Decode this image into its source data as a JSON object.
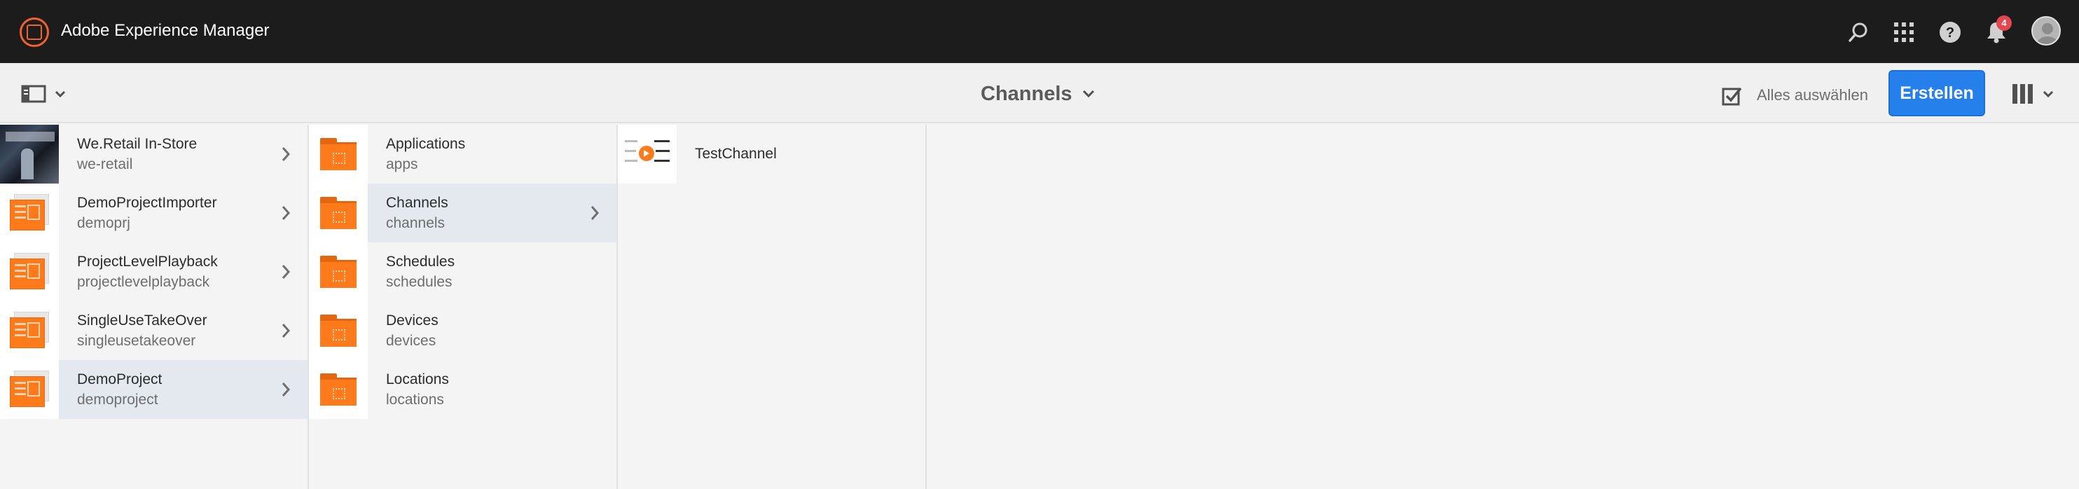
{
  "header": {
    "app_title": "Adobe Experience Manager",
    "notification_count": "4",
    "icons": [
      "search-icon",
      "apps-grid-icon",
      "help-icon",
      "bell-icon",
      "user-avatar"
    ]
  },
  "actionbar": {
    "breadcrumb": "Channels",
    "select_all_label": "Alles auswählen",
    "create_label": "Erstellen"
  },
  "columns": {
    "projects": [
      {
        "title": "We.Retail In-Store",
        "name": "we-retail",
        "has_children": true,
        "active": false
      },
      {
        "title": "DemoProjectImporter",
        "name": "demoprj",
        "has_children": true,
        "active": false
      },
      {
        "title": "ProjectLevelPlayback",
        "name": "projectlevelplayback",
        "has_children": true,
        "active": false
      },
      {
        "title": "SingleUseTakeOver",
        "name": "singleusetakeover",
        "has_children": true,
        "active": false
      },
      {
        "title": "DemoProject",
        "name": "demoproject",
        "has_children": true,
        "active": true
      }
    ],
    "folders": [
      {
        "title": "Applications",
        "name": "apps",
        "active": false
      },
      {
        "title": "Channels",
        "name": "channels",
        "active": true
      },
      {
        "title": "Schedules",
        "name": "schedules",
        "active": false
      },
      {
        "title": "Devices",
        "name": "devices",
        "active": false
      },
      {
        "title": "Locations",
        "name": "locations",
        "active": false
      }
    ],
    "channels": [
      {
        "title": "TestChannel"
      }
    ]
  },
  "colors": {
    "accent": "#2680eb",
    "brand_orange": "#ff7a1a",
    "topbar": "#1c1c1c",
    "active_row": "#e4e9f0",
    "badge": "#e34850"
  }
}
